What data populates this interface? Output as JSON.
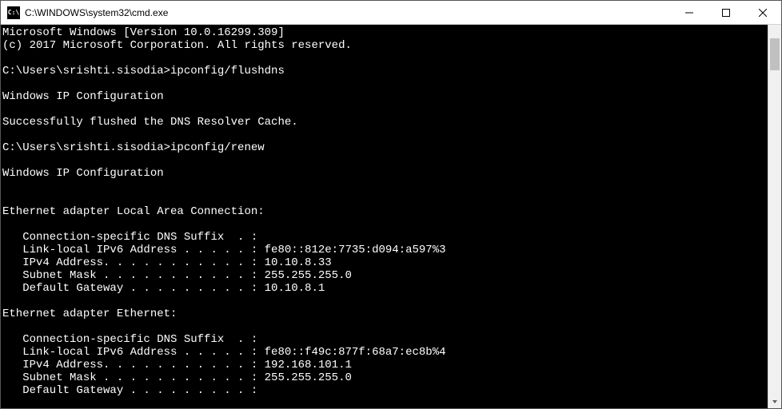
{
  "titlebar": {
    "icon_label": "C:\\",
    "title": "C:\\WINDOWS\\system32\\cmd.exe"
  },
  "terminal": {
    "lines": [
      "Microsoft Windows [Version 10.0.16299.309]",
      "(c) 2017 Microsoft Corporation. All rights reserved.",
      "",
      "C:\\Users\\srishti.sisodia>ipconfig/flushdns",
      "",
      "Windows IP Configuration",
      "",
      "Successfully flushed the DNS Resolver Cache.",
      "",
      "C:\\Users\\srishti.sisodia>ipconfig/renew",
      "",
      "Windows IP Configuration",
      "",
      "",
      "Ethernet adapter Local Area Connection:",
      "",
      "   Connection-specific DNS Suffix  . :",
      "   Link-local IPv6 Address . . . . . : fe80::812e:7735:d094:a597%3",
      "   IPv4 Address. . . . . . . . . . . : 10.10.8.33",
      "   Subnet Mask . . . . . . . . . . . : 255.255.255.0",
      "   Default Gateway . . . . . . . . . : 10.10.8.1",
      "",
      "Ethernet adapter Ethernet:",
      "",
      "   Connection-specific DNS Suffix  . :",
      "   Link-local IPv6 Address . . . . . : fe80::f49c:877f:68a7:ec8b%4",
      "   IPv4 Address. . . . . . . . . . . : 192.168.101.1",
      "   Subnet Mask . . . . . . . . . . . : 255.255.255.0",
      "   Default Gateway . . . . . . . . . :"
    ]
  }
}
